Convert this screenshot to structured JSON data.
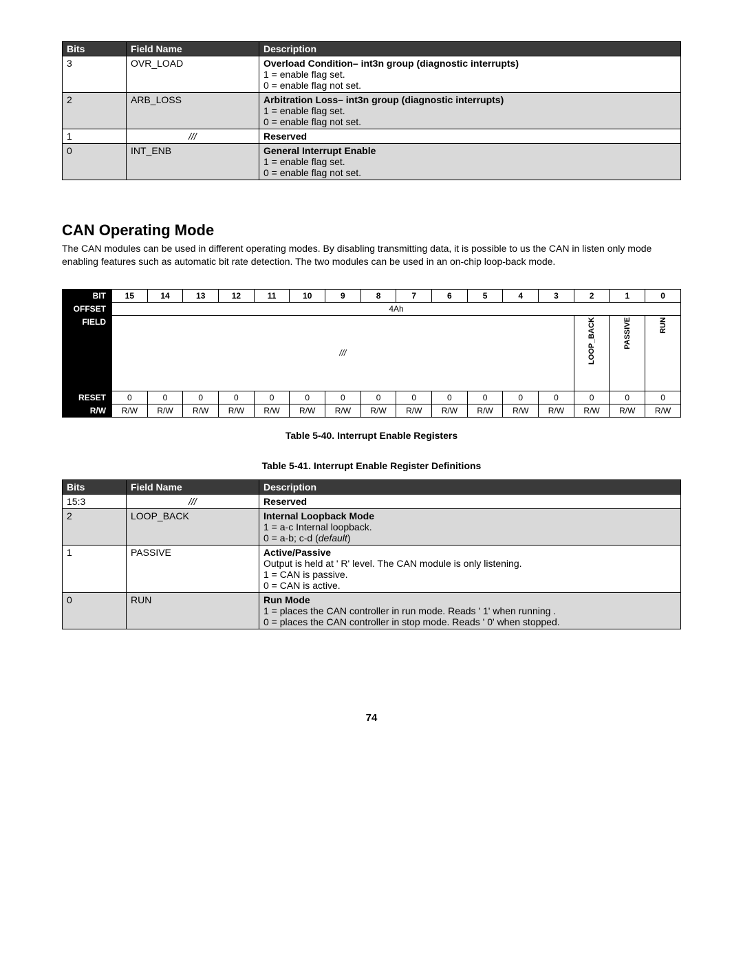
{
  "table1": {
    "headers": {
      "bits": "Bits",
      "field": "Field Name",
      "desc": "Description"
    },
    "rows": [
      {
        "bits": "3",
        "field": "OVR_LOAD",
        "title": "Overload Condition– int3n group (diagnostic interrupts)",
        "line1": "1 = enable flag set.",
        "line2": "0 = enable flag not set.",
        "alt": false
      },
      {
        "bits": "2",
        "field": "ARB_LOSS",
        "title": "Arbitration Loss– int3n group (diagnostic interrupts)",
        "line1": "1 = enable flag set.",
        "line2": "0 = enable flag not set.",
        "alt": true
      },
      {
        "bits": "1",
        "field": "///",
        "title": "Reserved",
        "line1": "",
        "line2": "",
        "alt": false
      },
      {
        "bits": "0",
        "field": "INT_ENB",
        "title": "General Interrupt Enable",
        "line1": "1 = enable flag set.",
        "line2": "0 = enable flag not set.",
        "alt": true
      }
    ]
  },
  "section": {
    "heading": "CAN Operating Mode",
    "para": "The CAN modules can be used in different operating modes. By disabling transmitting data, it is possible to us the CAN in listen only mode enabling features such as automatic bit rate detection. The two modules can be used in an on-chip loop-back mode."
  },
  "reg": {
    "label_bit": "BIT",
    "label_offset": "OFFSET",
    "label_field": "FIELD",
    "label_reset": "RESET",
    "label_rw": "R/W",
    "bits": [
      "15",
      "14",
      "13",
      "12",
      "11",
      "10",
      "9",
      "8",
      "7",
      "6",
      "5",
      "4",
      "3",
      "2",
      "1",
      "0"
    ],
    "offset": "4Ah",
    "field_slashes": "///",
    "field_loopback": "LOOP_BACK",
    "field_passive": "PASSIVE",
    "field_run": "RUN",
    "reset_val": "0",
    "rw_val": "R/W"
  },
  "caption1": "Table 5-40. Interrupt Enable Registers",
  "caption2": "Table 5-41. Interrupt Enable Register Definitions",
  "table2": {
    "headers": {
      "bits": "Bits",
      "field": "Field Name",
      "desc": "Description"
    },
    "row0": {
      "bits": "15:3",
      "field": "///",
      "title": "Reserved"
    },
    "row1": {
      "bits": "2",
      "field": "LOOP_BACK",
      "title": "Internal Loopback Mode",
      "l1": "1 = a-c Internal loopback.",
      "l2a": "0 = a-b; c-d (",
      "l2b": "default",
      "l2c": ")"
    },
    "row2": {
      "bits": "1",
      "field": "PASSIVE",
      "title": "Active/Passive",
      "l1": "Output is held at ' R' level. The CAN module is only listening.",
      "l2": "1 = CAN is passive.",
      "l3": "0 = CAN is active."
    },
    "row3": {
      "bits": "0",
      "field": "RUN",
      "title": "Run Mode",
      "l1": "1 = places the CAN controller in run mode.  Reads ' 1' when running .",
      "l2": "0 = places the CAN controller in stop mode. Reads ' 0' when stopped."
    }
  },
  "pagenum": "74"
}
